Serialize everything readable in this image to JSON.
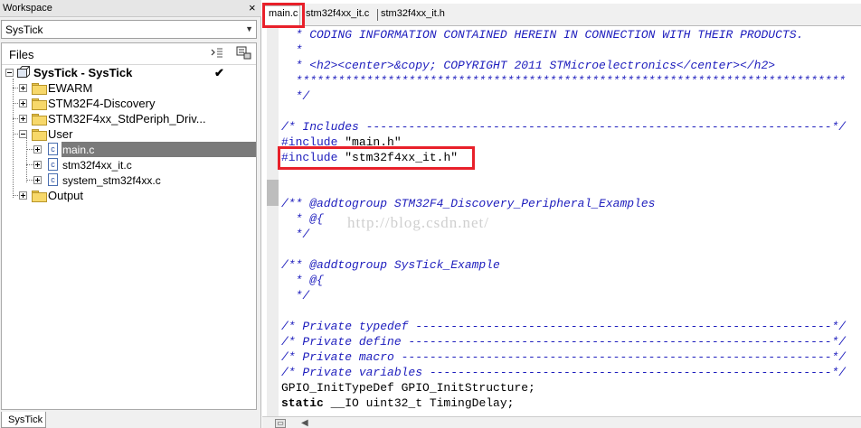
{
  "workspace": {
    "title": "Workspace",
    "close_glyph": "×",
    "selector_value": "SysTick",
    "files_header": "Files",
    "bottom_tab": "SysTick",
    "tree": {
      "project": "SysTick - SysTick",
      "project_checked": "✔",
      "folders": [
        {
          "label": "EWARM",
          "expand": "+"
        },
        {
          "label": "STM32F4-Discovery",
          "expand": "+"
        },
        {
          "label": "STM32F4xx_StdPeriph_Driv...",
          "expand": "+"
        },
        {
          "label": "User",
          "expand": "-"
        }
      ],
      "user_files": [
        "main.c",
        "stm32f4xx_it.c",
        "system_stm32f4xx.c"
      ],
      "output_folder": "Output",
      "file_icon_letter": "c"
    },
    "selected_item": "main.c"
  },
  "editor": {
    "tabs": [
      {
        "label": "main.c",
        "active": true
      },
      {
        "label": "stm32f4xx_it.c",
        "active": false
      },
      {
        "label": "stm32f4xx_it.h",
        "active": false
      }
    ],
    "lines": [
      "  * CODING INFORMATION CONTAINED HEREIN IN CONNECTION WITH THEIR PRODUCTS.",
      "  *",
      "  * <h2><center>&copy; COPYRIGHT 2011 STMicroelectronics</center></h2>",
      "  ******************************************************************************",
      "  */",
      "",
      "/* Includes ------------------------------------------------------------------*/",
      "#include \"main.h\"",
      "#include \"stm32f4xx_it.h\"",
      "",
      "",
      "/** @addtogroup STM32F4_Discovery_Peripheral_Examples",
      "  * @{",
      "  */",
      "",
      "/** @addtogroup SysTick_Example",
      "  * @{",
      "  */",
      "",
      "",
      "/* Private typedef -----------------------------------------------------------*/",
      "/* Private define ------------------------------------------------------------*/",
      "/* Private macro -------------------------------------------------------------*/",
      "/* Private variables ---------------------------------------------------------*/",
      "GPIO_InitTypeDef GPIO_InitStructure;",
      "static __IO uint32_t TimingDelay;"
    ],
    "include_directive": "#include",
    "include_main_arg": " \"main.h\"",
    "include_it_arg": " \"stm32f4xx_it.h\"",
    "static_kw": "static",
    "static_rest": " __IO uint32_t TimingDelay;",
    "watermark": "http://blog.csdn.net/",
    "highlight_color": "#e8202a",
    "comment_color": "#1d1dbd"
  }
}
